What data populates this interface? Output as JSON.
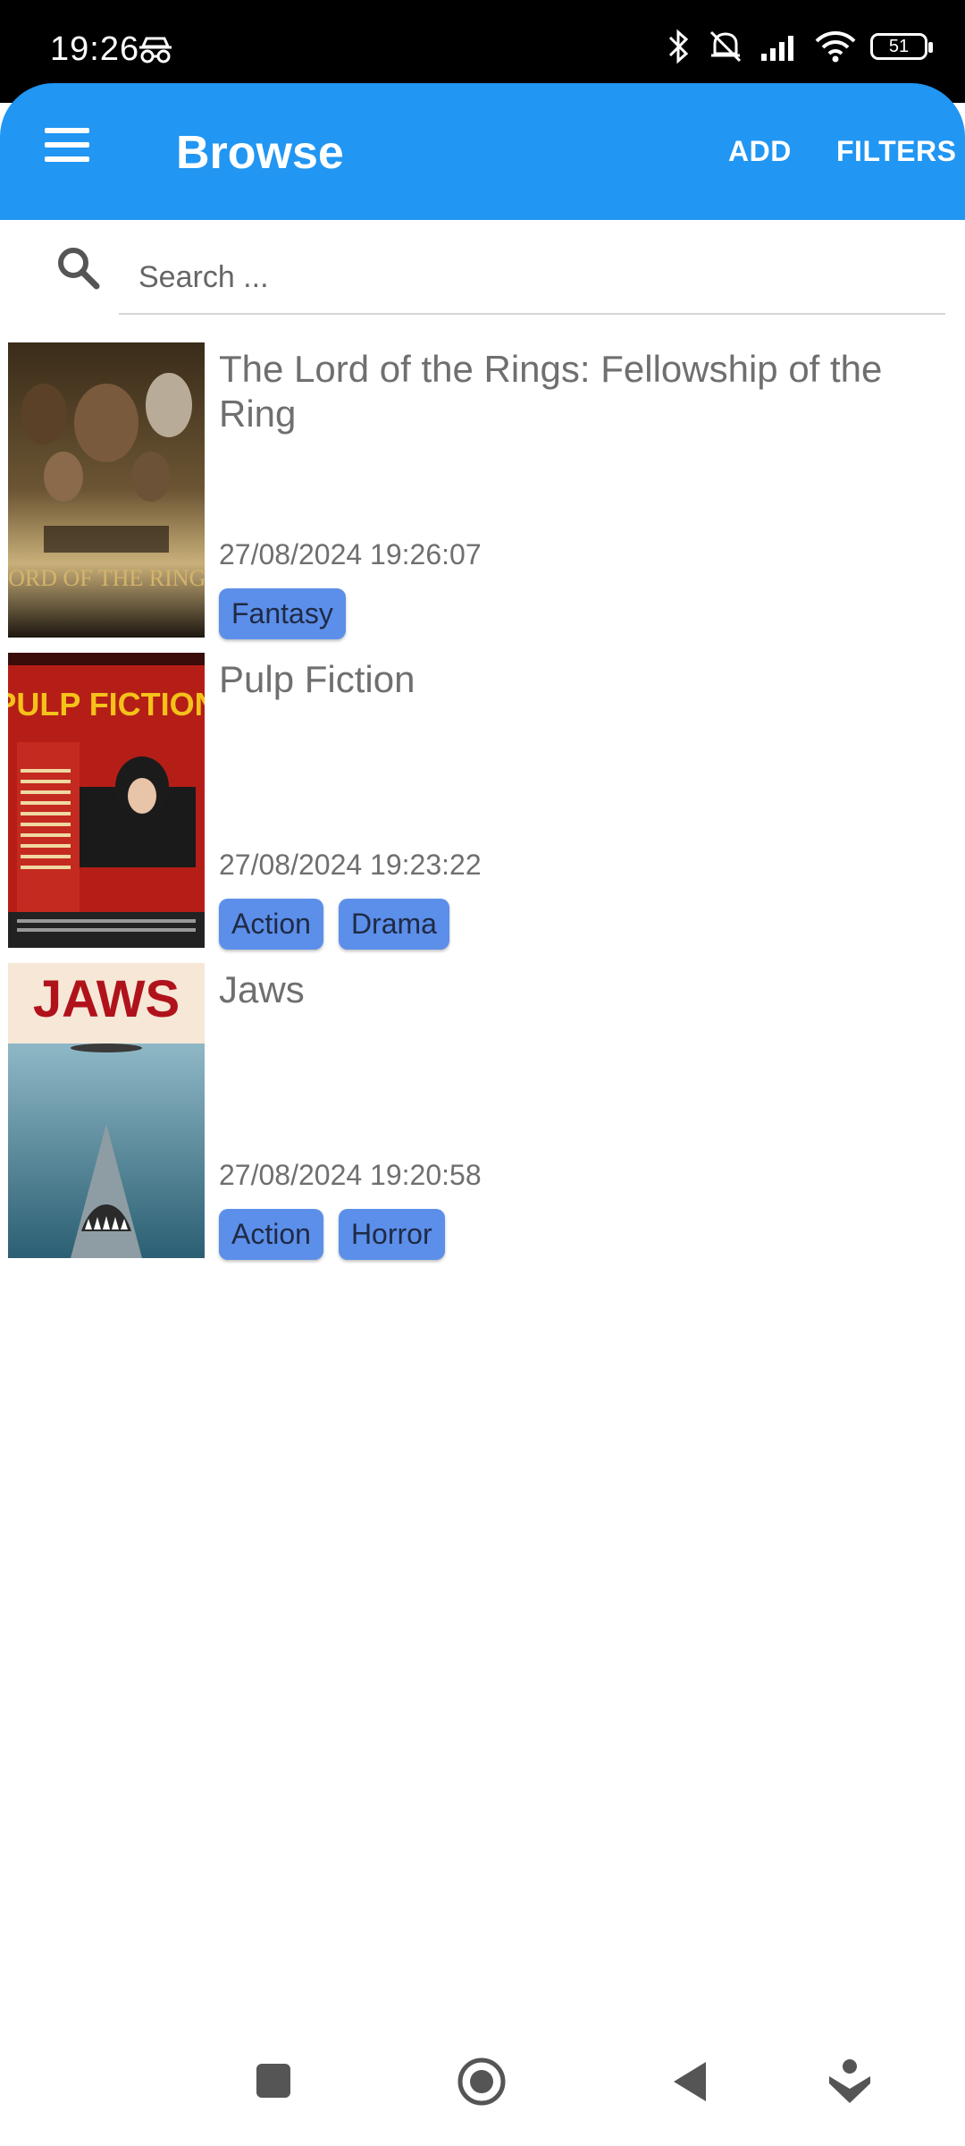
{
  "status_bar": {
    "time": "19:26",
    "battery": "51",
    "icons": [
      "incognito-icon",
      "bluetooth-icon",
      "silent-icon",
      "signal-icon",
      "wifi-icon",
      "battery-icon"
    ]
  },
  "app_bar": {
    "title": "Browse",
    "add_label": "ADD",
    "filters_label": "FILTERS",
    "color": "#2196F3"
  },
  "search": {
    "placeholder": "Search ..."
  },
  "movies": [
    {
      "title": "The Lord of the Rings: Fellowship of the Ring",
      "date": "27/08/2024 19:26:07",
      "tags": [
        "Fantasy"
      ]
    },
    {
      "title": "Pulp Fiction",
      "date": "27/08/2024 19:23:22",
      "tags": [
        "Action",
        "Drama"
      ]
    },
    {
      "title": "Jaws",
      "date": "27/08/2024 19:20:58",
      "tags": [
        "Action",
        "Horror"
      ]
    }
  ],
  "posters": {
    "lotr_logo": "LORD OF THE RINGS",
    "pulp_logo": "PULP FICTION",
    "jaws_logo": "JAWS"
  },
  "nav_bar": {
    "icons": [
      "square-icon",
      "home-circle-icon",
      "back-triangle-icon",
      "accessibility-icon"
    ]
  }
}
